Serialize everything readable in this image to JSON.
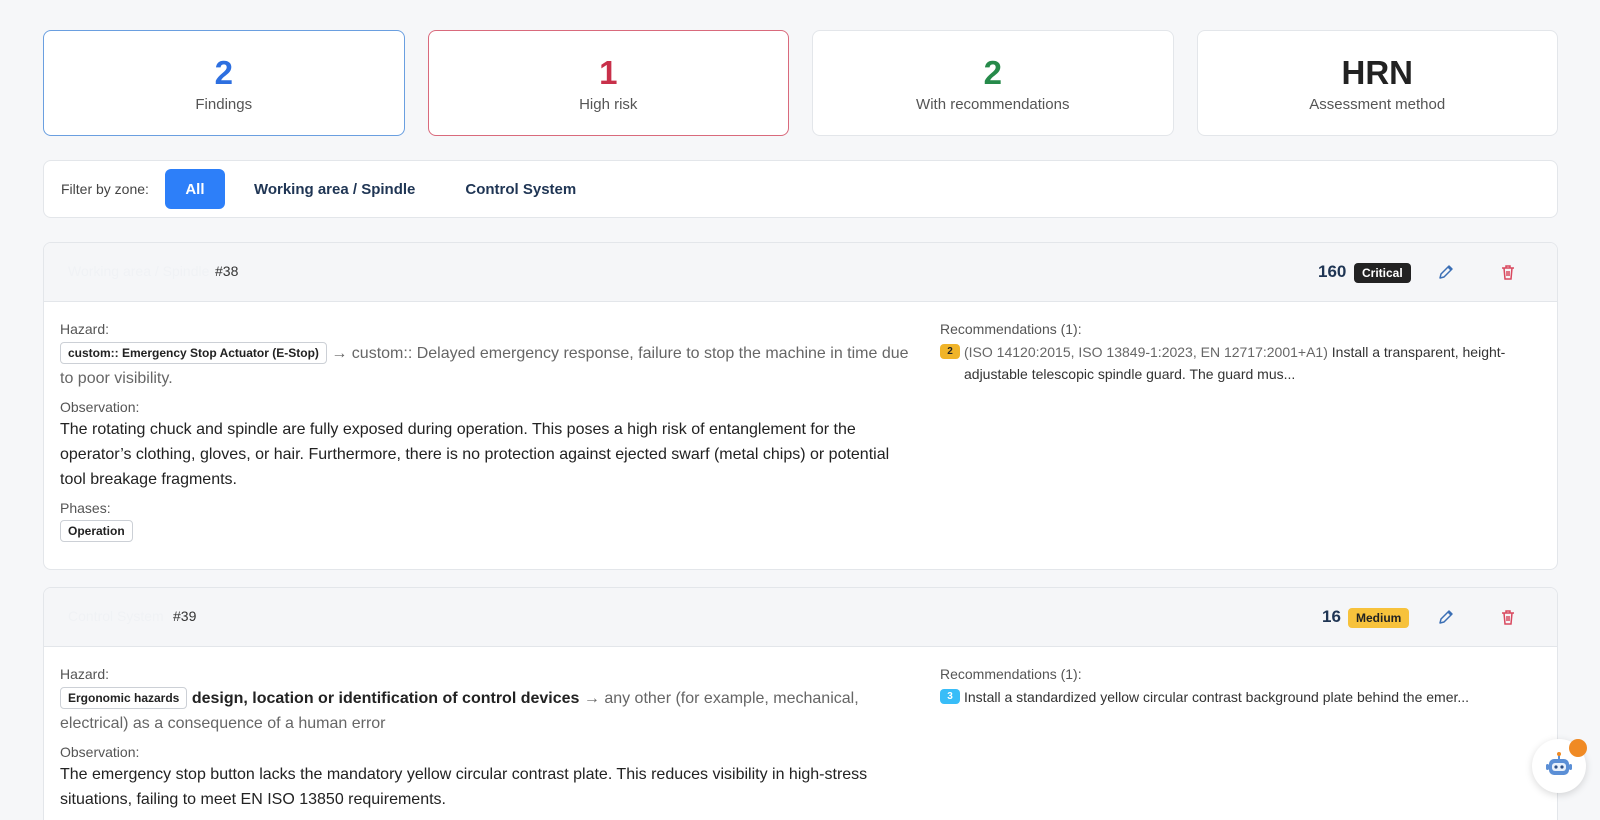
{
  "stats": [
    {
      "value": "2",
      "label": "Findings",
      "color": "#2d6fe0"
    },
    {
      "value": "1",
      "label": "High risk",
      "color": "#c8304a"
    },
    {
      "value": "2",
      "label": "With recommendations",
      "color": "#268a4a"
    },
    {
      "value": "HRN",
      "label": "Assessment method",
      "color": "#222222"
    }
  ],
  "filter": {
    "label": "Filter by zone:",
    "options": [
      "All",
      "Working area / Spindle",
      "Control System"
    ],
    "active": "All"
  },
  "findings": [
    {
      "zone": "Working area / Spindle",
      "id": "#38",
      "score": "160",
      "severity": "Critical",
      "hazard_label": "Hazard:",
      "hazard_tag": "custom:: Emergency Stop Actuator (E-Stop)",
      "hazard_title": "",
      "hazard_arrow": "→ custom:: Delayed emergency response, failure to stop the machine in time due to poor visibility.",
      "observation_label": "Observation:",
      "observation": "The rotating chuck and spindle are fully exposed during operation. This poses a high risk of entanglement for the operator’s clothing, gloves, or hair. Furthermore, there is no protection against ejected swarf (metal chips) or potential tool breakage fragments.",
      "phases_label": "Phases:",
      "phases": [
        "Operation"
      ],
      "recommendations_label": "Recommendations (1):",
      "recommendations": [
        {
          "num": "2",
          "standards": "(ISO 14120:2015, ISO 13849-1:2023, EN 12717:2001+A1)",
          "text": " Install a transparent, height-adjustable telescopic spindle guard. The guard mus..."
        }
      ]
    },
    {
      "zone": "Control System",
      "id": "#39",
      "score": "16",
      "severity": "Medium",
      "hazard_label": "Hazard:",
      "hazard_tag": "Ergonomic hazards",
      "hazard_title": "design, location or identification of control devices",
      "hazard_arrow": " → any other (for example, mechanical, electrical) as a consequence of a human error",
      "observation_label": "Observation:",
      "observation": "The emergency stop button lacks the mandatory yellow circular contrast plate. This reduces visibility in high-stress situations, failing to meet EN ISO 13850 requirements.",
      "recommendations_label": "Recommendations (1):",
      "recommendations": [
        {
          "num": "3",
          "standards": "",
          "text": "Install a standardized yellow circular contrast background plate behind the emer..."
        }
      ]
    }
  ]
}
